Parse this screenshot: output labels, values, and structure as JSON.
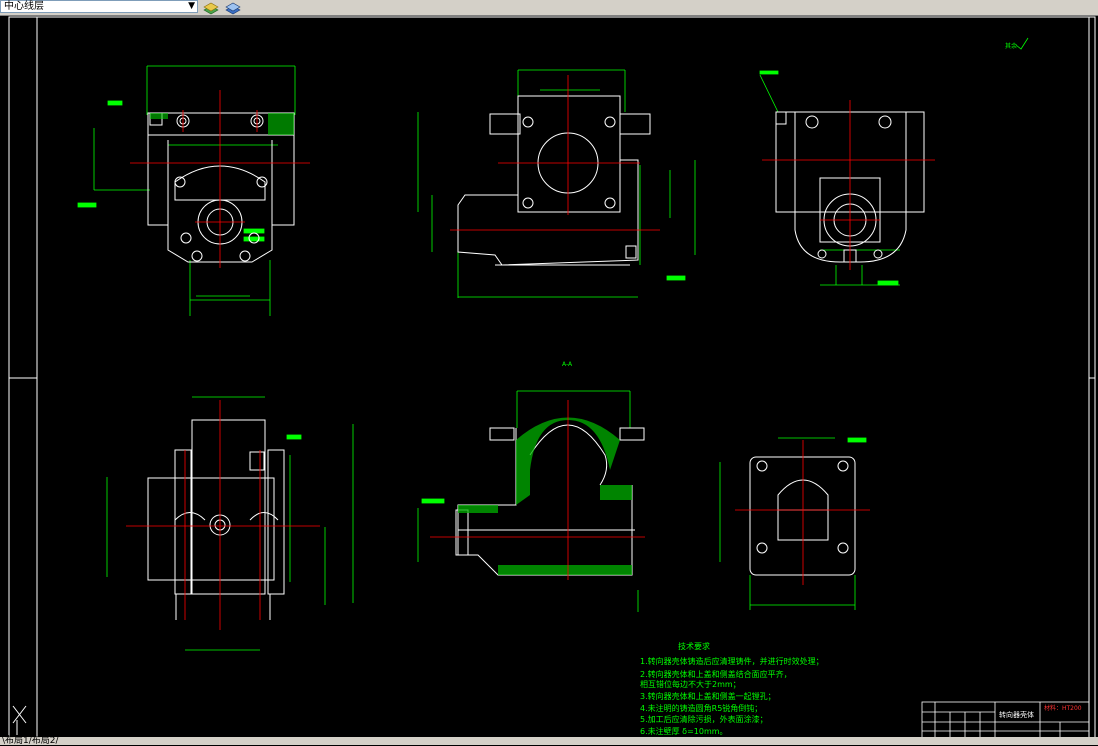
{
  "toolbar": {
    "layer_value": "中心线层",
    "layer_options_icon": "chevron-down-icon",
    "layer_states_icon": "layer-states-icon",
    "layer_previous_icon": "layer-previous-icon"
  },
  "drawing": {
    "section_label": "A-A",
    "roughness_note": "其余",
    "tech_title": "技术要求",
    "tech_requirements": [
      "1.转向器壳体铸造后应清理铸件，并进行时效处理；",
      "2.转向器壳体和上盖和侧盖结合面应平齐，",
      "   相互错位每边不大于2mm；",
      "3.转向器壳体和上盖和侧盖一起镗孔；",
      "4.未注明的铸造圆角R5锐角倒钝；",
      "5.加工后应清除污损，外表面涂漆；",
      "6.未注壁厚 δ=10mm。"
    ],
    "title_block": {
      "part_name": "转向器壳体",
      "material": "材料：HT200"
    },
    "colors": {
      "outline": "#ffffff",
      "dimension": "#00ff00",
      "centerline": "#ff0000",
      "frame": "#ffffff",
      "material_text": "#ff0000"
    }
  },
  "status": {
    "tabs": "\\布局1/布局2/"
  }
}
